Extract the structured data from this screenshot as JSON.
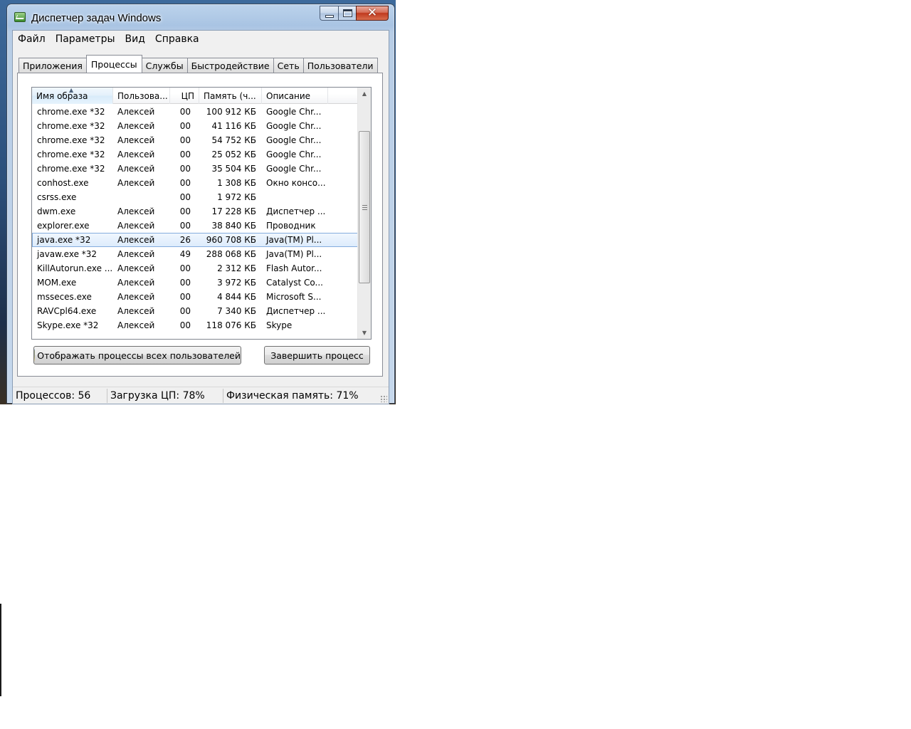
{
  "window": {
    "title": "Диспетчер задач Windows"
  },
  "menu": [
    "Файл",
    "Параметры",
    "Вид",
    "Справка"
  ],
  "tabs": [
    "Приложения",
    "Процессы",
    "Службы",
    "Быстродействие",
    "Сеть",
    "Пользователи"
  ],
  "active_tab": "Процессы",
  "table": {
    "columns": [
      "Имя образа",
      "Пользова...",
      "ЦП",
      "Память (ч...",
      "Описание"
    ],
    "sorted_column": "Имя образа",
    "rows": [
      [
        "chrome.exe *32",
        "Алексей",
        "00",
        "100 912 КБ",
        "Google Chr..."
      ],
      [
        "chrome.exe *32",
        "Алексей",
        "00",
        "41 116 КБ",
        "Google Chr..."
      ],
      [
        "chrome.exe *32",
        "Алексей",
        "00",
        "54 752 КБ",
        "Google Chr..."
      ],
      [
        "chrome.exe *32",
        "Алексей",
        "00",
        "25 052 КБ",
        "Google Chr..."
      ],
      [
        "chrome.exe *32",
        "Алексей",
        "00",
        "35 504 КБ",
        "Google Chr..."
      ],
      [
        "conhost.exe",
        "Алексей",
        "00",
        "1 308 КБ",
        "Окно консо..."
      ],
      [
        "csrss.exe",
        "",
        "00",
        "1 972 КБ",
        ""
      ],
      [
        "dwm.exe",
        "Алексей",
        "00",
        "17 228 КБ",
        "Диспетчер ..."
      ],
      [
        "explorer.exe",
        "Алексей",
        "00",
        "38 840 КБ",
        "Проводник"
      ],
      [
        "java.exe *32",
        "Алексей",
        "26",
        "960 708 КБ",
        "Java(TM) Pl..."
      ],
      [
        "javaw.exe *32",
        "Алексей",
        "49",
        "288 068 КБ",
        "Java(TM) Pl..."
      ],
      [
        "KillAutorun.exe ...",
        "Алексей",
        "00",
        "2 312 КБ",
        "Flash Autor..."
      ],
      [
        "MOM.exe",
        "Алексей",
        "00",
        "3 972 КБ",
        "Catalyst Co..."
      ],
      [
        "msseces.exe",
        "Алексей",
        "00",
        "4 844 КБ",
        "Microsoft S..."
      ],
      [
        "RAVCpl64.exe",
        "Алексей",
        "00",
        "7 340 КБ",
        "Диспетчер ..."
      ],
      [
        "Skype.exe *32",
        "Алексей",
        "00",
        "118 076 КБ",
        "Skype"
      ]
    ],
    "selected_row": 9
  },
  "buttons": {
    "show_all": "Отображать процессы всех пользователей",
    "end_process": "Завершить процесс"
  },
  "status": {
    "processes": "Процессов: 56",
    "cpu": "Загрузка ЦП: 78%",
    "memory": "Физическая память: 71%"
  },
  "colors": {
    "selection": "#dcebfc",
    "selection_border": "#84acdd",
    "close_button": "#c0391e"
  }
}
